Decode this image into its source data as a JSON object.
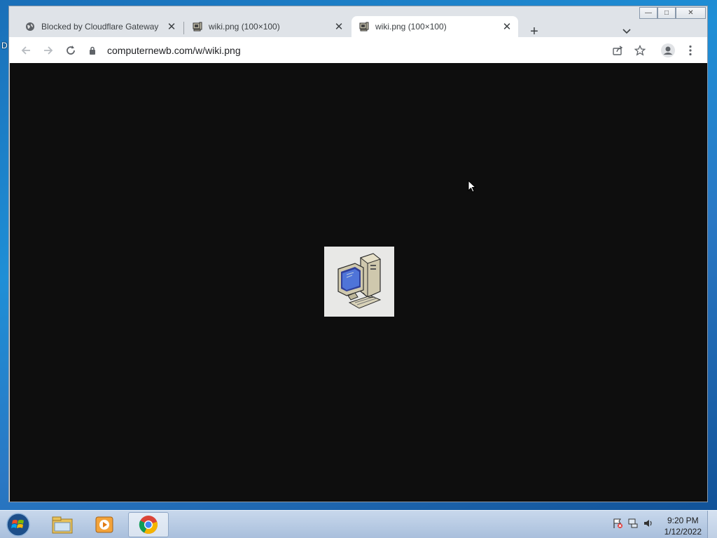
{
  "desktop": {
    "label": "D"
  },
  "window": {
    "caption": {
      "minimize": "—",
      "maximize": "□",
      "close": "✕"
    }
  },
  "tabs": [
    {
      "title": "Blocked by Cloudflare Gateway",
      "favicon": "globe-icon",
      "active": false
    },
    {
      "title": "wiki.png (100×100)",
      "favicon": "computer-icon",
      "active": false
    },
    {
      "title": "wiki.png (100×100)",
      "favicon": "computer-icon",
      "active": true
    }
  ],
  "tab_close": "✕",
  "new_tab": "+",
  "address_bar": {
    "url": "computernewb.com/w/wiki.png"
  },
  "taskbar": {
    "apps": [
      "start-orb-icon",
      "file-explorer-icon",
      "media-player-icon",
      "chrome-icon"
    ],
    "clock": {
      "time": "9:20 PM",
      "date": "1/12/2022"
    }
  },
  "colors": {
    "accent": "#1a73e8",
    "viewport_bg": "#0e0e0e",
    "taskbar": "#b5c8e2"
  }
}
